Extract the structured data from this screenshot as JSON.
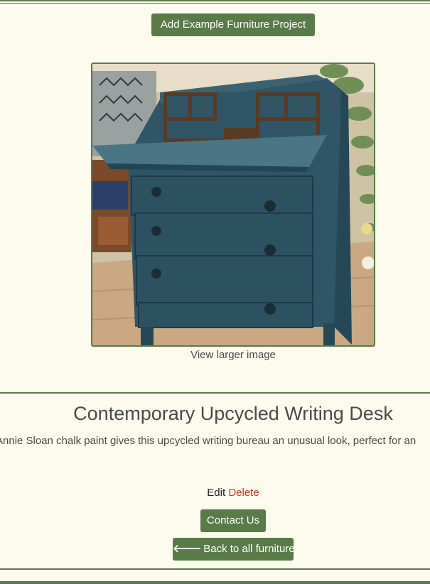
{
  "header": {
    "add_button_label": "Add Example Furniture Project"
  },
  "product": {
    "image_alt": "Blue painted upcycled writing bureau with open flap",
    "view_larger_label": "View larger image",
    "title": "Contemporary Upcycled Writing Desk",
    "description": "Annie Sloan chalk paint gives this upcycled writing bureau an unusual look, perfect for an"
  },
  "admin": {
    "edit_label": "Edit",
    "delete_label": "Delete"
  },
  "actions": {
    "contact_label": "Contact Us",
    "back_label": "Back to all furniture",
    "back_icon": "arrow-left-icon"
  },
  "colors": {
    "background": "#fdfaee",
    "accent_green": "#587b47",
    "delete_red": "#c0392b",
    "text": "#4a4a4a"
  }
}
